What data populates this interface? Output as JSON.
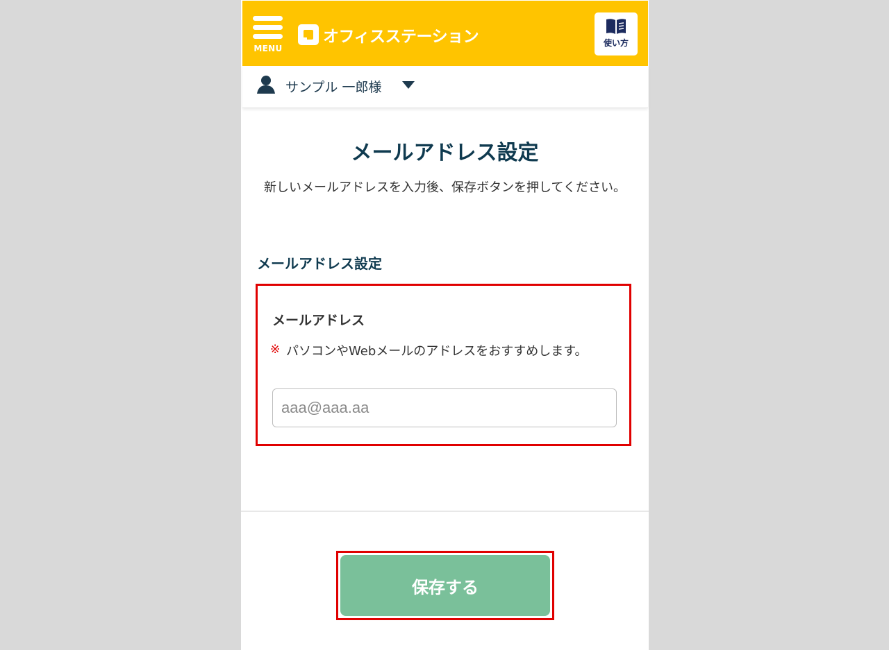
{
  "header": {
    "menu_label": "MENU",
    "logo_text": "オフィスステーション",
    "help_label": "使い方",
    "bg_color": "#ffc400"
  },
  "user": {
    "name": "サンプル 一郎様"
  },
  "page": {
    "title": "メールアドレス設定",
    "description": "新しいメールアドレスを入力後、保存ボタンを押してください。"
  },
  "section": {
    "title": "メールアドレス設定",
    "field_label": "メールアドレス",
    "note_mark": "※",
    "note_text": "パソコンやWebメールのアドレスをおすすめします。",
    "email_placeholder": "aaa@aaa.aa",
    "email_value": ""
  },
  "actions": {
    "save_label": "保存する",
    "save_color": "#7ac09a",
    "highlight_color": "#e00000"
  }
}
